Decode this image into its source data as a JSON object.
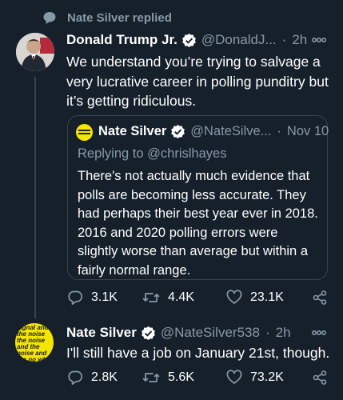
{
  "context": {
    "replied_label": "Nate Silver replied"
  },
  "tweets": [
    {
      "name": "Donald Trump Jr.",
      "handle": "@DonaldJ...",
      "dot": "·",
      "time": "2h",
      "text": "We understand you’re trying to salvage a very lucrative career in polling punditry but it’s getting ridiculous.",
      "stats": {
        "replies": "3.1K",
        "retweets": "4.4K",
        "likes": "23.1K"
      }
    },
    {
      "name": "Nate Silver",
      "handle": "@NateSilver538",
      "dot": "·",
      "time": "2h",
      "text": "I'll still have a job on January 21st, though.",
      "avatar_text": "signal and the noise the noise and the noise and the no why so many redictions fail some do",
      "stats": {
        "replies": "2.8K",
        "retweets": "5.6K",
        "likes": "73.2K"
      }
    }
  ],
  "quoted": {
    "name": "Nate Silver",
    "handle": "@NateSilve...",
    "dot": "·",
    "time": "Nov 10",
    "replying_to_prefix": "Replying to",
    "replying_to_handle": "@chrislhayes",
    "text": "There's not actually much evidence that polls are becoming less accurate. They had perhaps their best year ever in 2018. 2016 and 2020 polling errors were slightly worse than average but within a fairly normal range."
  },
  "colors": {
    "background": "#15202b",
    "secondary_text": "#8899a6",
    "verified": "#ffffff",
    "border": "#38444d"
  }
}
